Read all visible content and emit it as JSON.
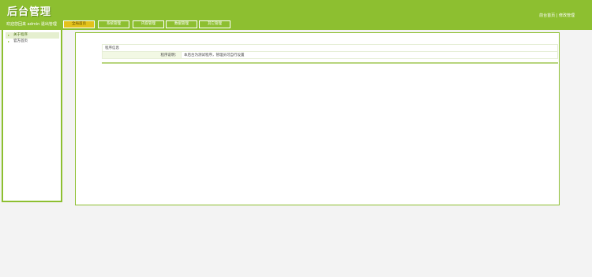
{
  "header": {
    "title": "后台管理",
    "welcome": "欢迎您回来 admin  退出管理",
    "links": [
      "前台首页",
      "修改管理"
    ]
  },
  "tabs": [
    {
      "label": "全局首页",
      "active": true
    },
    {
      "label": "系统管理",
      "active": false
    },
    {
      "label": "内容管理",
      "active": false
    },
    {
      "label": "数据管理",
      "active": false
    },
    {
      "label": "其它管理",
      "active": false
    }
  ],
  "sidebar": {
    "items": [
      {
        "label": "关于程序",
        "active": true
      },
      {
        "label": "官方首页",
        "active": false
      }
    ]
  },
  "main": {
    "section_title": "程序信息",
    "rows": [
      {
        "label": "程序说明：",
        "value": "本后台为测试程序，管理员可自行设置"
      }
    ]
  },
  "colors": {
    "brand_green": "#8dbf30",
    "active_tab": "#e3c21b"
  }
}
